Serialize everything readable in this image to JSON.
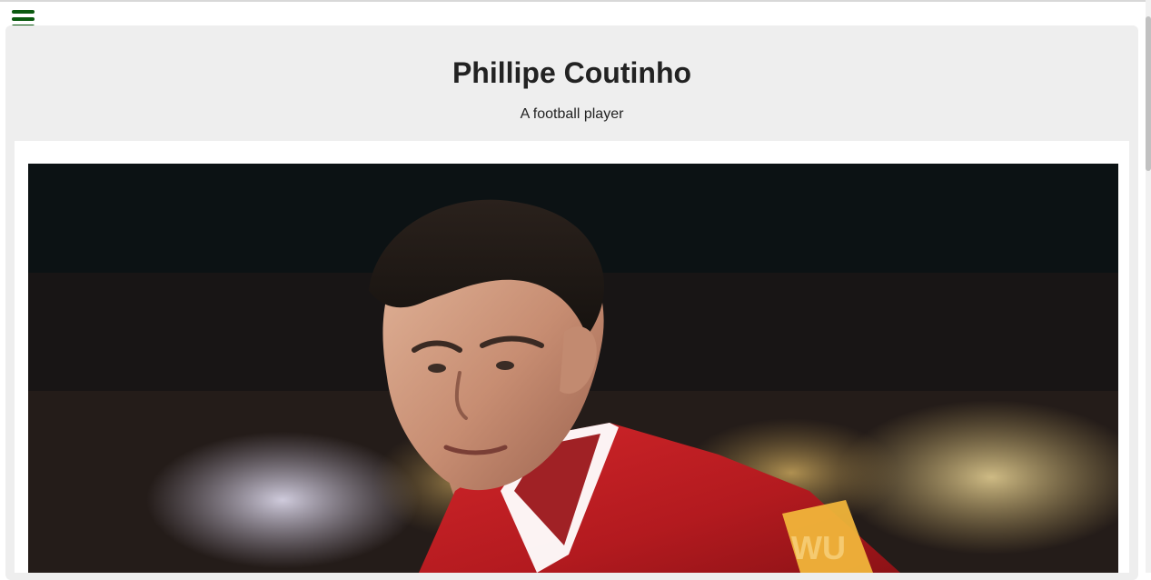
{
  "header": {
    "menu_icon": "hamburger-menu-icon",
    "menu_color": "#0b5a10"
  },
  "page": {
    "title": "Phillipe Coutinho",
    "subtitle": "A football player"
  },
  "image": {
    "description_icon": "player-photo"
  }
}
